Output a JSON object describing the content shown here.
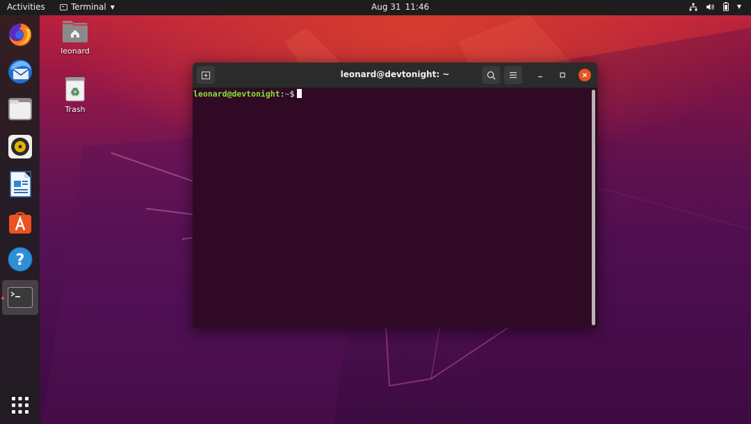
{
  "topbar": {
    "activities_label": "Activities",
    "app_menu_label": "Terminal",
    "date": "Aug 31",
    "time": "11:46"
  },
  "dock": {
    "items": [
      {
        "name": "firefox",
        "icon": "firefox-icon"
      },
      {
        "name": "thunderbird",
        "icon": "thunderbird-icon"
      },
      {
        "name": "files",
        "icon": "files-icon"
      },
      {
        "name": "rhythmbox",
        "icon": "rhythmbox-icon"
      },
      {
        "name": "libreoffice-writer",
        "icon": "writer-icon"
      },
      {
        "name": "ubuntu-software",
        "icon": "software-icon"
      },
      {
        "name": "help",
        "icon": "help-icon"
      },
      {
        "name": "terminal",
        "icon": "terminal-icon",
        "active": true
      }
    ],
    "show_apps_icon": "show-applications-icon"
  },
  "desktop": {
    "icons": [
      {
        "label": "leonard",
        "icon": "home-folder-icon"
      },
      {
        "label": "Trash",
        "icon": "trash-icon"
      }
    ]
  },
  "terminal": {
    "title": "leonard@devtonight: ~",
    "prompt_user": "leonard@devtonight",
    "prompt_sep": ":",
    "prompt_path": "~",
    "prompt_symbol": "$",
    "colors": {
      "background": "#300a24",
      "user": "#8ae234",
      "path": "#729fcf",
      "close_button": "#e95420"
    }
  }
}
